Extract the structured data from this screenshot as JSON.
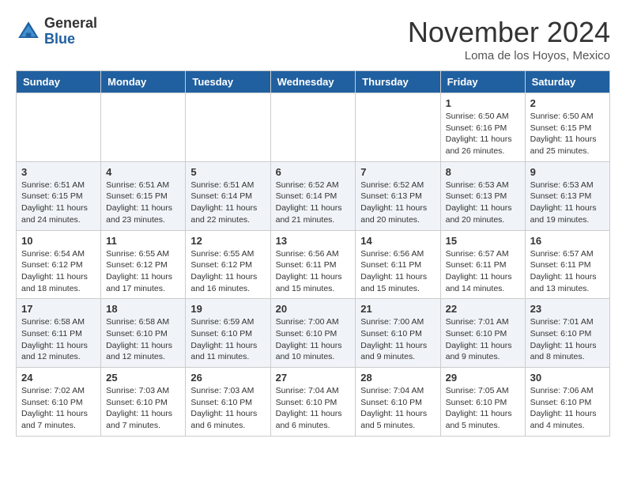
{
  "header": {
    "logo_general": "General",
    "logo_blue": "Blue",
    "month_title": "November 2024",
    "location": "Loma de los Hoyos, Mexico"
  },
  "weekdays": [
    "Sunday",
    "Monday",
    "Tuesday",
    "Wednesday",
    "Thursday",
    "Friday",
    "Saturday"
  ],
  "weeks": [
    [
      {
        "day": "",
        "info": ""
      },
      {
        "day": "",
        "info": ""
      },
      {
        "day": "",
        "info": ""
      },
      {
        "day": "",
        "info": ""
      },
      {
        "day": "",
        "info": ""
      },
      {
        "day": "1",
        "info": "Sunrise: 6:50 AM\nSunset: 6:16 PM\nDaylight: 11 hours and 26 minutes."
      },
      {
        "day": "2",
        "info": "Sunrise: 6:50 AM\nSunset: 6:15 PM\nDaylight: 11 hours and 25 minutes."
      }
    ],
    [
      {
        "day": "3",
        "info": "Sunrise: 6:51 AM\nSunset: 6:15 PM\nDaylight: 11 hours and 24 minutes."
      },
      {
        "day": "4",
        "info": "Sunrise: 6:51 AM\nSunset: 6:15 PM\nDaylight: 11 hours and 23 minutes."
      },
      {
        "day": "5",
        "info": "Sunrise: 6:51 AM\nSunset: 6:14 PM\nDaylight: 11 hours and 22 minutes."
      },
      {
        "day": "6",
        "info": "Sunrise: 6:52 AM\nSunset: 6:14 PM\nDaylight: 11 hours and 21 minutes."
      },
      {
        "day": "7",
        "info": "Sunrise: 6:52 AM\nSunset: 6:13 PM\nDaylight: 11 hours and 20 minutes."
      },
      {
        "day": "8",
        "info": "Sunrise: 6:53 AM\nSunset: 6:13 PM\nDaylight: 11 hours and 20 minutes."
      },
      {
        "day": "9",
        "info": "Sunrise: 6:53 AM\nSunset: 6:13 PM\nDaylight: 11 hours and 19 minutes."
      }
    ],
    [
      {
        "day": "10",
        "info": "Sunrise: 6:54 AM\nSunset: 6:12 PM\nDaylight: 11 hours and 18 minutes."
      },
      {
        "day": "11",
        "info": "Sunrise: 6:55 AM\nSunset: 6:12 PM\nDaylight: 11 hours and 17 minutes."
      },
      {
        "day": "12",
        "info": "Sunrise: 6:55 AM\nSunset: 6:12 PM\nDaylight: 11 hours and 16 minutes."
      },
      {
        "day": "13",
        "info": "Sunrise: 6:56 AM\nSunset: 6:11 PM\nDaylight: 11 hours and 15 minutes."
      },
      {
        "day": "14",
        "info": "Sunrise: 6:56 AM\nSunset: 6:11 PM\nDaylight: 11 hours and 15 minutes."
      },
      {
        "day": "15",
        "info": "Sunrise: 6:57 AM\nSunset: 6:11 PM\nDaylight: 11 hours and 14 minutes."
      },
      {
        "day": "16",
        "info": "Sunrise: 6:57 AM\nSunset: 6:11 PM\nDaylight: 11 hours and 13 minutes."
      }
    ],
    [
      {
        "day": "17",
        "info": "Sunrise: 6:58 AM\nSunset: 6:11 PM\nDaylight: 11 hours and 12 minutes."
      },
      {
        "day": "18",
        "info": "Sunrise: 6:58 AM\nSunset: 6:10 PM\nDaylight: 11 hours and 12 minutes."
      },
      {
        "day": "19",
        "info": "Sunrise: 6:59 AM\nSunset: 6:10 PM\nDaylight: 11 hours and 11 minutes."
      },
      {
        "day": "20",
        "info": "Sunrise: 7:00 AM\nSunset: 6:10 PM\nDaylight: 11 hours and 10 minutes."
      },
      {
        "day": "21",
        "info": "Sunrise: 7:00 AM\nSunset: 6:10 PM\nDaylight: 11 hours and 9 minutes."
      },
      {
        "day": "22",
        "info": "Sunrise: 7:01 AM\nSunset: 6:10 PM\nDaylight: 11 hours and 9 minutes."
      },
      {
        "day": "23",
        "info": "Sunrise: 7:01 AM\nSunset: 6:10 PM\nDaylight: 11 hours and 8 minutes."
      }
    ],
    [
      {
        "day": "24",
        "info": "Sunrise: 7:02 AM\nSunset: 6:10 PM\nDaylight: 11 hours and 7 minutes."
      },
      {
        "day": "25",
        "info": "Sunrise: 7:03 AM\nSunset: 6:10 PM\nDaylight: 11 hours and 7 minutes."
      },
      {
        "day": "26",
        "info": "Sunrise: 7:03 AM\nSunset: 6:10 PM\nDaylight: 11 hours and 6 minutes."
      },
      {
        "day": "27",
        "info": "Sunrise: 7:04 AM\nSunset: 6:10 PM\nDaylight: 11 hours and 6 minutes."
      },
      {
        "day": "28",
        "info": "Sunrise: 7:04 AM\nSunset: 6:10 PM\nDaylight: 11 hours and 5 minutes."
      },
      {
        "day": "29",
        "info": "Sunrise: 7:05 AM\nSunset: 6:10 PM\nDaylight: 11 hours and 5 minutes."
      },
      {
        "day": "30",
        "info": "Sunrise: 7:06 AM\nSunset: 6:10 PM\nDaylight: 11 hours and 4 minutes."
      }
    ]
  ]
}
